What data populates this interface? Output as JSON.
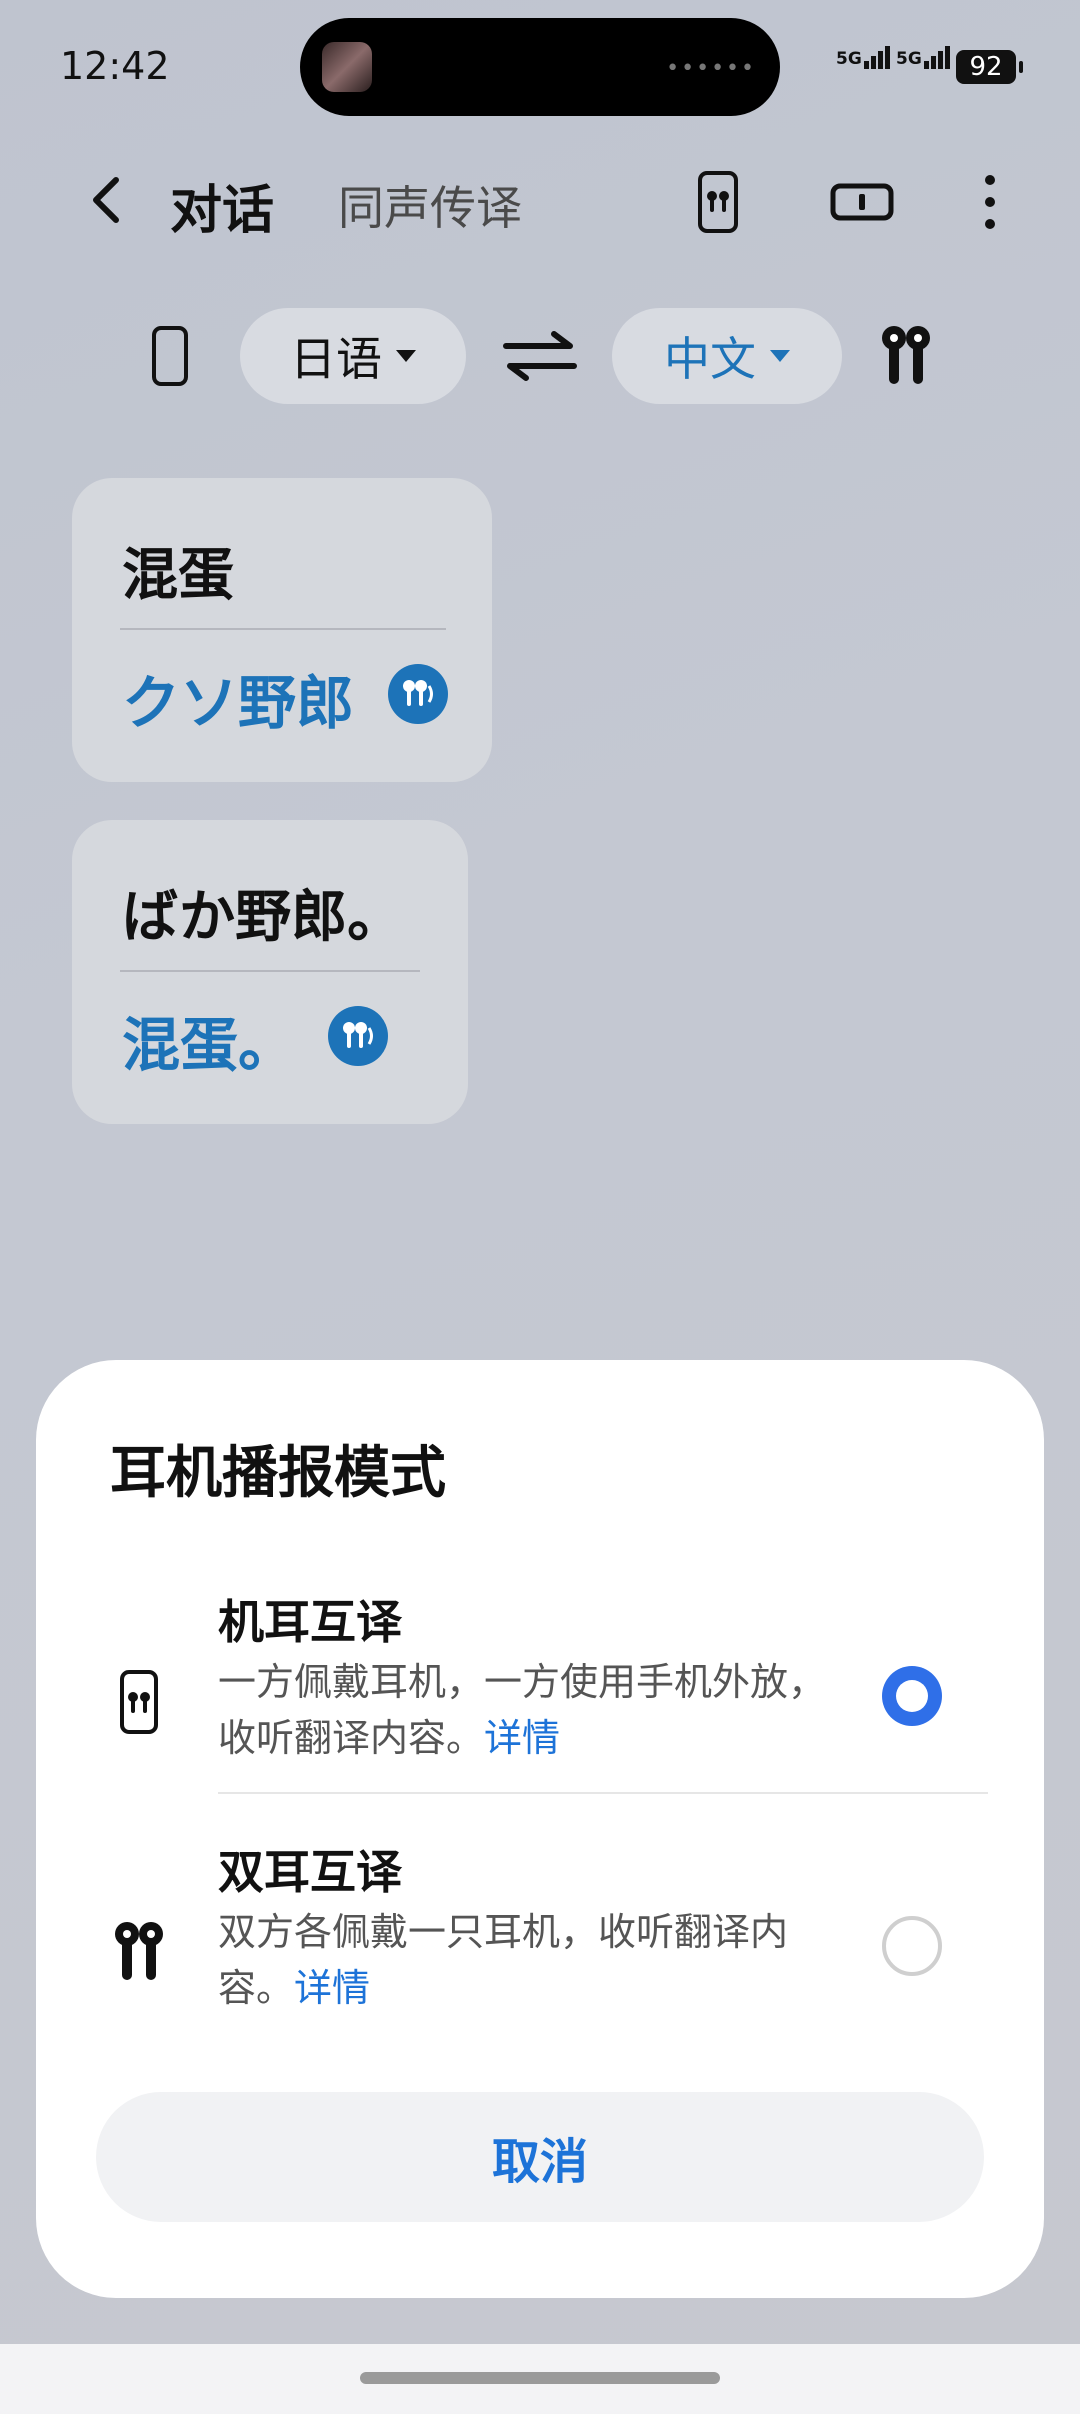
{
  "status": {
    "time": "12:42",
    "signal1": "5G",
    "signal2": "5G",
    "battery": "92"
  },
  "header": {
    "title": "对话",
    "subtitle": "同声传译"
  },
  "languages": {
    "source": "日语",
    "target": "中文"
  },
  "messages": [
    {
      "source": "混蛋",
      "translation": "クソ野郎"
    },
    {
      "source": "ばか野郎。",
      "translation": "混蛋。"
    }
  ],
  "sheet": {
    "title": "耳机播报模式",
    "options": [
      {
        "title": "机耳互译",
        "desc": "一方佩戴耳机，一方使用手机外放，收听翻译内容。",
        "link": "详情",
        "selected": true
      },
      {
        "title": "双耳互译",
        "desc": "双方各佩戴一只耳机，收听翻译内容。",
        "link": "详情",
        "selected": false
      }
    ],
    "cancel": "取消"
  },
  "colors": {
    "accent": "#1d73b8",
    "link": "#1d73d8",
    "radio_on": "#2f6fe8"
  },
  "icons": {
    "back": "chevron-left-icon",
    "phone_earbuds": "phone-earbuds-icon",
    "split_screen": "split-screen-icon",
    "more": "more-vertical-icon",
    "phone": "phone-icon",
    "swap": "swap-arrows-icon",
    "earbuds": "earbuds-icon",
    "play_audio": "earbud-audio-icon"
  }
}
